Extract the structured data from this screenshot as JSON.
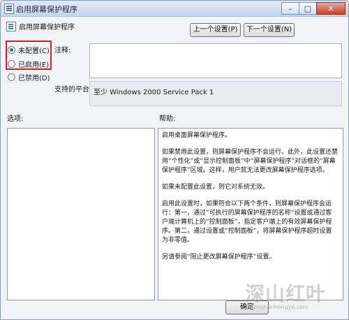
{
  "window": {
    "title": "启用屏幕保护程序",
    "controls": [
      "–",
      "□",
      "✕"
    ]
  },
  "policy": {
    "name": "启用屏幕保护程序"
  },
  "nav": {
    "prev_label": "上一个设置(P)",
    "next_label": "下一个设置(N)"
  },
  "state_options": [
    {
      "label": "未配置(C)",
      "selected": true
    },
    {
      "label": "已启用(E)",
      "selected": false
    },
    {
      "label": "已禁用(D)",
      "selected": false
    }
  ],
  "comment": {
    "label": "注释:",
    "value": ""
  },
  "supported": {
    "label": "支持的平台:",
    "value": "至少 Windows 2000 Service Pack 1"
  },
  "options": {
    "label": "选项:"
  },
  "help": {
    "label": "帮助:",
    "paragraphs": [
      "启用桌面屏幕保护程序。",
      "如果禁用此设置，则屏幕保护程序不会运行。此外，此设置还禁用“个性化”或“显示控制面板”中“屏幕保护程序”对话框的“屏幕保护程序”区域。这样，用户就无法更改屏幕保护程序选项。",
      "如果未配置此设置，则它对系统无效。",
      "启用此设置时，如果符合以下两个条件，则屏幕保护程序会运行：第一，通过“可执行的屏幕保护程序的名称”设置或通过客户端计算机上的“控制面板”，指定客户端上的有效屏幕保护程序。第二，通过设置或“控制面板”，将屏幕保护程序超时设置为非零值。",
      "另请参阅“阻止更改屏幕保护程序”设置。"
    ]
  },
  "footer": {
    "ok_label": "确定"
  },
  "watermark": {
    "cn": "深山红叶",
    "en": "shenshanhongye.com"
  },
  "colors": {
    "highlight_box": "#d61e1e",
    "accent": "#2a6cc2"
  }
}
